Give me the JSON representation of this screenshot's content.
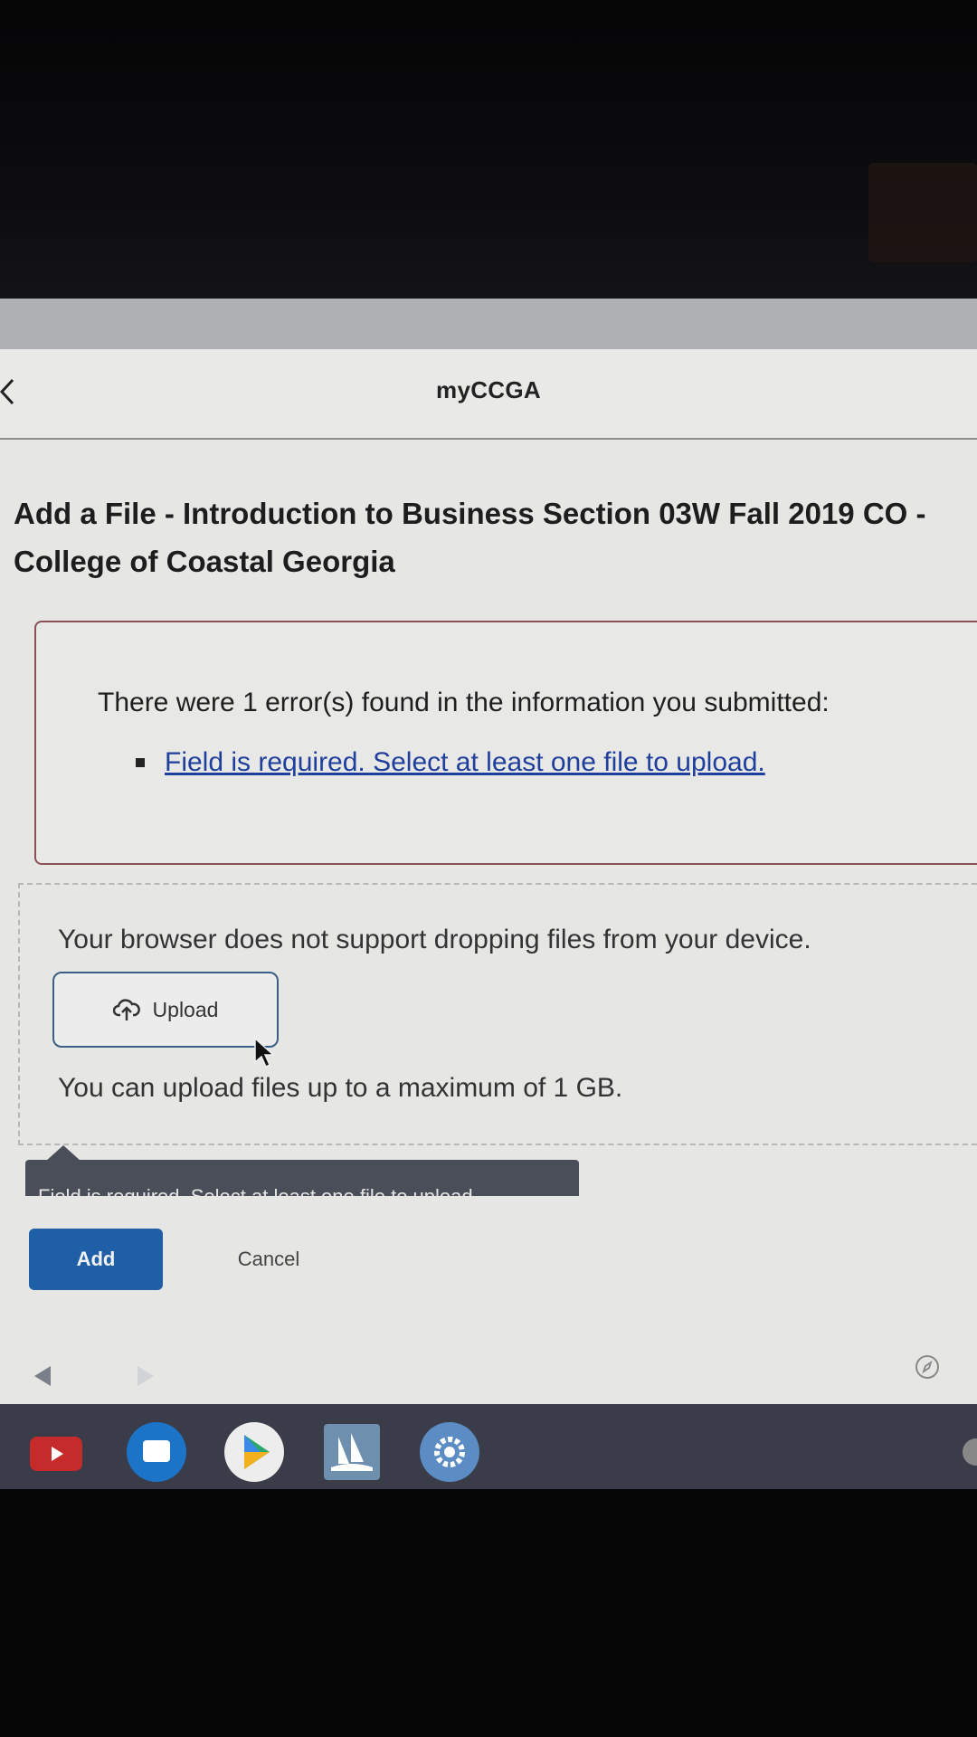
{
  "app": {
    "site_title": "myCCGA",
    "back_icon": "chevron-left-icon"
  },
  "page": {
    "title": "Add a File - Introduction to Business Section 03W Fall 2019 CO - College of Coastal Georgia"
  },
  "error_panel": {
    "heading": "There were 1 error(s) found in the information you submitted:",
    "errors": [
      "Field is required. Select at least one file to upload."
    ],
    "border_color": "#8d5058",
    "link_color": "#1f3f9c"
  },
  "drop_zone": {
    "unsupported_text": "Your browser does not support dropping files from your device.",
    "upload_label": "Upload",
    "upload_icon": "cloud-upload-icon",
    "limit_text": "You can upload files up to a maximum of 1 GB."
  },
  "tooltip": {
    "text": "Field is required. Select at least one file to upload."
  },
  "actions": {
    "add_label": "Add",
    "cancel_label": "Cancel",
    "primary_color": "#1e5fa8"
  },
  "shelf": {
    "apps": [
      "youtube-icon",
      "messages-icon",
      "play-store-icon",
      "ccga-app-icon",
      "settings-icon"
    ]
  }
}
